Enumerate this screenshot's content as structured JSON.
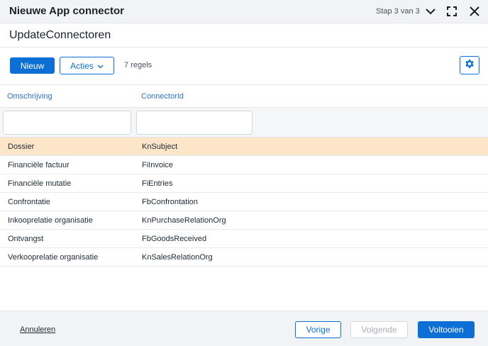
{
  "header": {
    "title": "Nieuwe App connector",
    "step": "Stap 3 van 3"
  },
  "page": {
    "subtitle": "UpdateConnectoren"
  },
  "toolbar": {
    "new_label": "Nieuw",
    "actions_label": "Acties",
    "rows_count": "7 regels"
  },
  "table": {
    "columns": [
      "Omschrijving",
      "ConnectorId"
    ],
    "filter_values": [
      "",
      ""
    ],
    "rows": [
      {
        "description": "Dossier",
        "connector_id": "KnSubject"
      },
      {
        "description": "Financiële factuur",
        "connector_id": "FiInvoice"
      },
      {
        "description": "Financiële mutatie",
        "connector_id": "FiEntries"
      },
      {
        "description": "Confrontatie",
        "connector_id": "FbConfrontation"
      },
      {
        "description": "Inkooprelatie organisatie",
        "connector_id": "KnPurchaseRelationOrg"
      },
      {
        "description": "Ontvangst",
        "connector_id": "FbGoodsReceived"
      },
      {
        "description": "Verkooprelatie organisatie",
        "connector_id": "KnSalesRelationOrg"
      }
    ],
    "selected_row_index": 0
  },
  "footer": {
    "cancel_label": "Annuleren",
    "previous_label": "Vorige",
    "next_label": "Volgende",
    "finish_label": "Voltooien"
  },
  "icons": {
    "collapse": "chevron-down-icon",
    "maximize": "maximize-icon",
    "close": "close-icon",
    "actions_dropdown": "chevron-down-icon",
    "settings": "gear-icon"
  },
  "colors": {
    "primary": "#0b6fd6",
    "selected_row": "#fde5c9",
    "column_header": "#2a73c4"
  }
}
